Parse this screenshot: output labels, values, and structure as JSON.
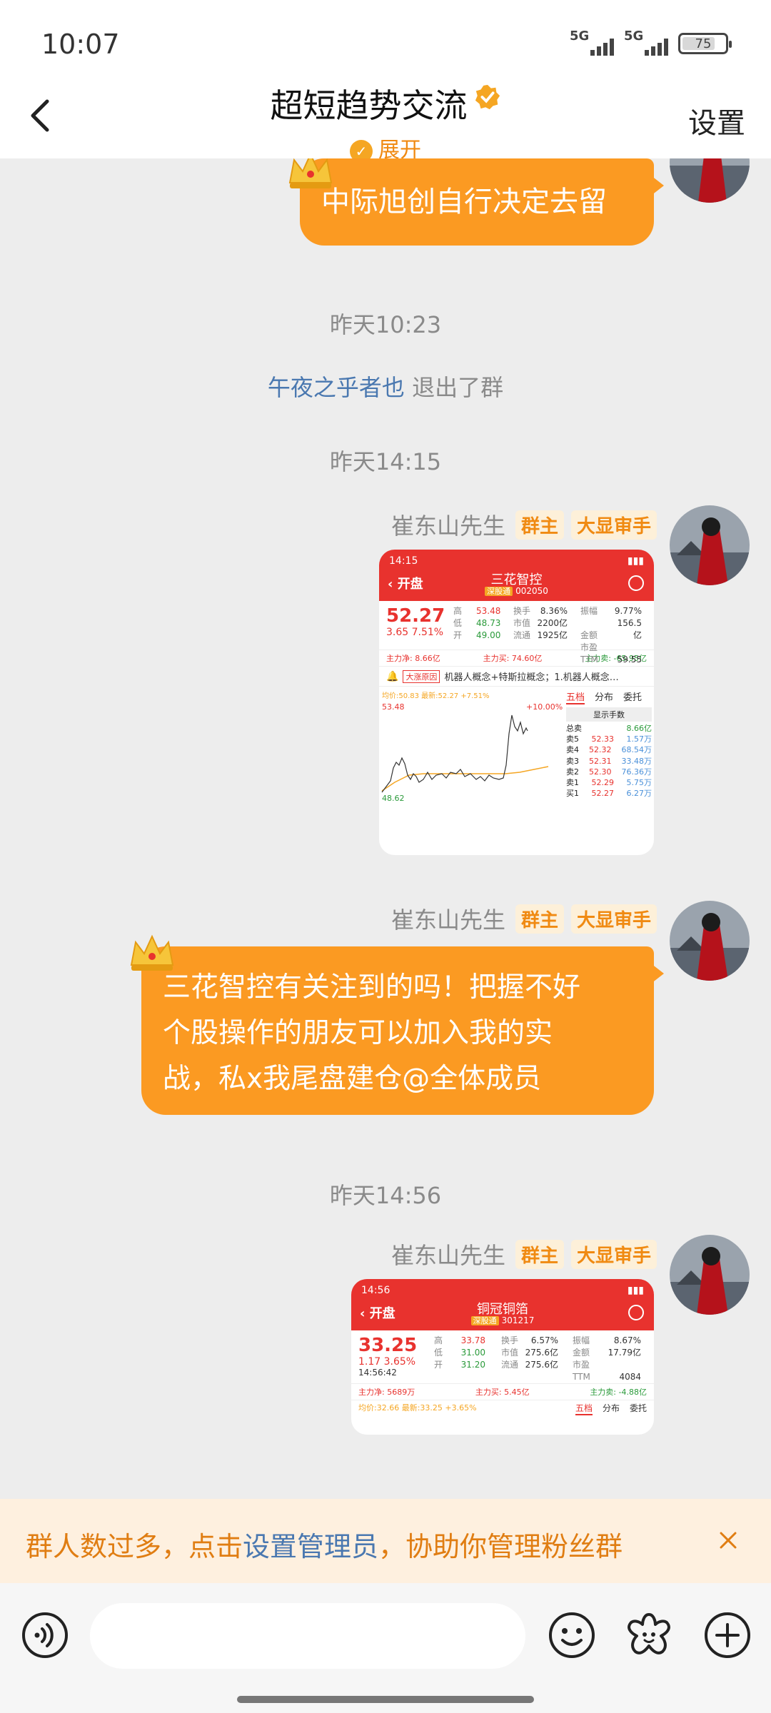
{
  "status_bar": {
    "time": "10:07",
    "signal1_label": "5G",
    "signal2_label": "5G",
    "battery": "75"
  },
  "nav": {
    "title": "超短趋势交流",
    "expand_label": "展开",
    "settings_label": "设置"
  },
  "colors": {
    "bubble_orange": "#fb9a22",
    "accent_orange": "#f08a12",
    "link_blue": "#4a78b0",
    "stock_red": "#e8322e"
  },
  "messages": {
    "msg1_text": "中际旭创自行决定去留",
    "time1": "昨天10:23",
    "sys_user": "午夜之乎者也",
    "sys_action": " 退出了群",
    "time2": "昨天14:15",
    "sender": "崔东山先生",
    "tag_owner": "群主",
    "tag_title": "大显审手",
    "msg2_line1": "三花智控有关注到的吗！把握不好",
    "msg2_line2": "个股操作的朋友可以加入我的实",
    "msg2_line3": "战，私x我尾盘建仓@全体成员",
    "time3": "昨天14:56"
  },
  "stock1": {
    "statusbar_time": "14:15",
    "open_btn": "开盘",
    "name": "三花智控",
    "market": "深股通",
    "code": "002050",
    "price": "52.27",
    "change": "3.65  7.51%",
    "stats": {
      "high_label": "高",
      "high": "53.48",
      "low_label": "低",
      "low": "48.73",
      "open_label": "开",
      "open": "49.00",
      "turnover_label": "换手",
      "turnover": "8.36%",
      "mktcap_label": "市值",
      "mktcap": "2200亿",
      "float_label": "流通",
      "float": "1925亿",
      "amp_label": "振幅",
      "amp": "9.77%",
      "amount_label": "金额",
      "amount": "156.5亿",
      "pe_label": "市盈TTM",
      "pe": "59.55"
    },
    "flow_net": "主力净: 8.66亿",
    "flow_buy": "主力买: 74.60亿",
    "flow_sell": "主力卖: -65.95亿",
    "concept_tag": "大涨原因",
    "concept_text": "机器人概念+特斯拉概念；1.机器人概念…",
    "chart_avg": "均价:50.83 最新:52.27 +7.51%",
    "chart_high": "53.48",
    "chart_low": "48.62",
    "chart_pct": "+10.00%",
    "tab1": "五档",
    "tab2": "分布",
    "tab3": "委托",
    "show_hands": "显示手数",
    "total_sell_label": "总卖",
    "total_sell": "8.66亿",
    "orderbook": [
      {
        "label": "卖5",
        "price": "52.33",
        "qty": "1.57万"
      },
      {
        "label": "卖4",
        "price": "52.32",
        "qty": "68.54万"
      },
      {
        "label": "卖3",
        "price": "52.31",
        "qty": "33.48万"
      },
      {
        "label": "卖2",
        "price": "52.30",
        "qty": "76.36万"
      },
      {
        "label": "卖1",
        "price": "52.29",
        "qty": "5.75万"
      },
      {
        "label": "买1",
        "price": "52.27",
        "qty": "6.27万"
      }
    ]
  },
  "stock2": {
    "statusbar_time": "14:56",
    "open_btn": "开盘",
    "name": "铜冠铜箔",
    "market": "深股通",
    "code": "301217",
    "price": "33.25",
    "change": "1.17  3.65%",
    "clock": "14:56:42",
    "stats": {
      "high_label": "高",
      "high": "33.78",
      "low_label": "低",
      "low": "31.00",
      "open_label": "开",
      "open": "31.20",
      "turnover_label": "换手",
      "turnover": "6.57%",
      "mktcap_label": "市值",
      "mktcap": "275.6亿",
      "float_label": "流通",
      "float": "275.6亿",
      "amp_label": "振幅",
      "amp": "8.67%",
      "amount_label": "金额",
      "amount": "17.79亿",
      "pe_label": "市盈TTM",
      "pe": "4084"
    },
    "flow_net": "主力净: 5689万",
    "flow_buy": "主力买: 5.45亿",
    "flow_sell": "主力卖: -4.88亿",
    "chart_avg": "均价:32.66 最新:33.25 +3.65%",
    "tab1": "五档",
    "tab2": "分布",
    "tab3": "委托"
  },
  "banner": {
    "text_before": "群人数过多，点击",
    "link": "设置管理员",
    "text_after": "，协助你管理粉丝群"
  },
  "input": {
    "placeholder": ""
  },
  "icons": {
    "back": "chevron-left-icon",
    "voice": "voice-icon",
    "emoji": "smiley-icon",
    "sticker": "flower-icon",
    "add": "plus-icon",
    "close": "close-icon"
  }
}
